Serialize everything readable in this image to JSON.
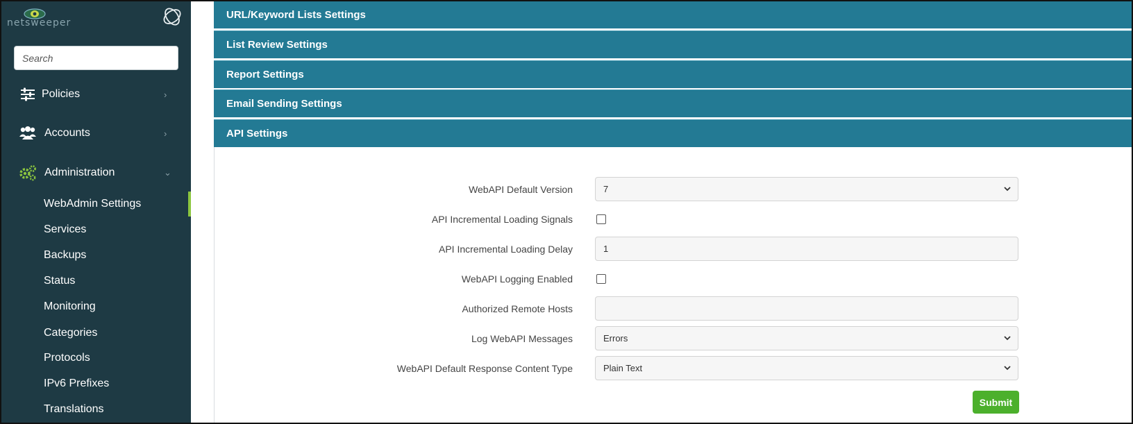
{
  "brand": {
    "wordmark": "netsweeper",
    "logo_icon": "netsweeper-eye-logo",
    "mark_icon": "netsweeper-orbit-mark"
  },
  "sidebar": {
    "search_placeholder": "Search",
    "nav": [
      {
        "label": "Policies",
        "icon": "sliders-icon",
        "expanded": false
      },
      {
        "label": "Accounts",
        "icon": "users-icon",
        "expanded": false
      },
      {
        "label": "Administration",
        "icon": "gears-icon",
        "expanded": true
      }
    ],
    "admin_items": [
      {
        "label": "WebAdmin Settings",
        "active": true
      },
      {
        "label": "Services"
      },
      {
        "label": "Backups"
      },
      {
        "label": "Status"
      },
      {
        "label": "Monitoring"
      },
      {
        "label": "Categories"
      },
      {
        "label": "Protocols"
      },
      {
        "label": "IPv6 Prefixes"
      },
      {
        "label": "Translations"
      }
    ],
    "colors": {
      "background": "#1e3a44",
      "active_indicator": "#8cc63f",
      "admin_icon": "#8cc63f"
    }
  },
  "sections": [
    {
      "title": "URL/Keyword Lists Settings"
    },
    {
      "title": "List Review Settings"
    },
    {
      "title": "Report Settings"
    },
    {
      "title": "Email Sending Settings"
    },
    {
      "title": "API Settings",
      "expanded": true
    }
  ],
  "api_settings": {
    "fields": [
      {
        "label": "WebAPI Default Version",
        "type": "select",
        "value": "7"
      },
      {
        "label": "API Incremental Loading Signals",
        "type": "checkbox",
        "checked": false
      },
      {
        "label": "API Incremental Loading Delay",
        "type": "text",
        "value": "1"
      },
      {
        "label": "WebAPI Logging Enabled",
        "type": "checkbox",
        "checked": false
      },
      {
        "label": "Authorized Remote Hosts",
        "type": "text",
        "value": ""
      },
      {
        "label": "Log WebAPI Messages",
        "type": "select",
        "value": "Errors"
      },
      {
        "label": "WebAPI Default Response Content Type",
        "type": "select",
        "value": "Plain Text"
      }
    ],
    "submit_label": "Submit"
  },
  "colors": {
    "section_header": "#237a94",
    "submit": "#4cb02c"
  }
}
